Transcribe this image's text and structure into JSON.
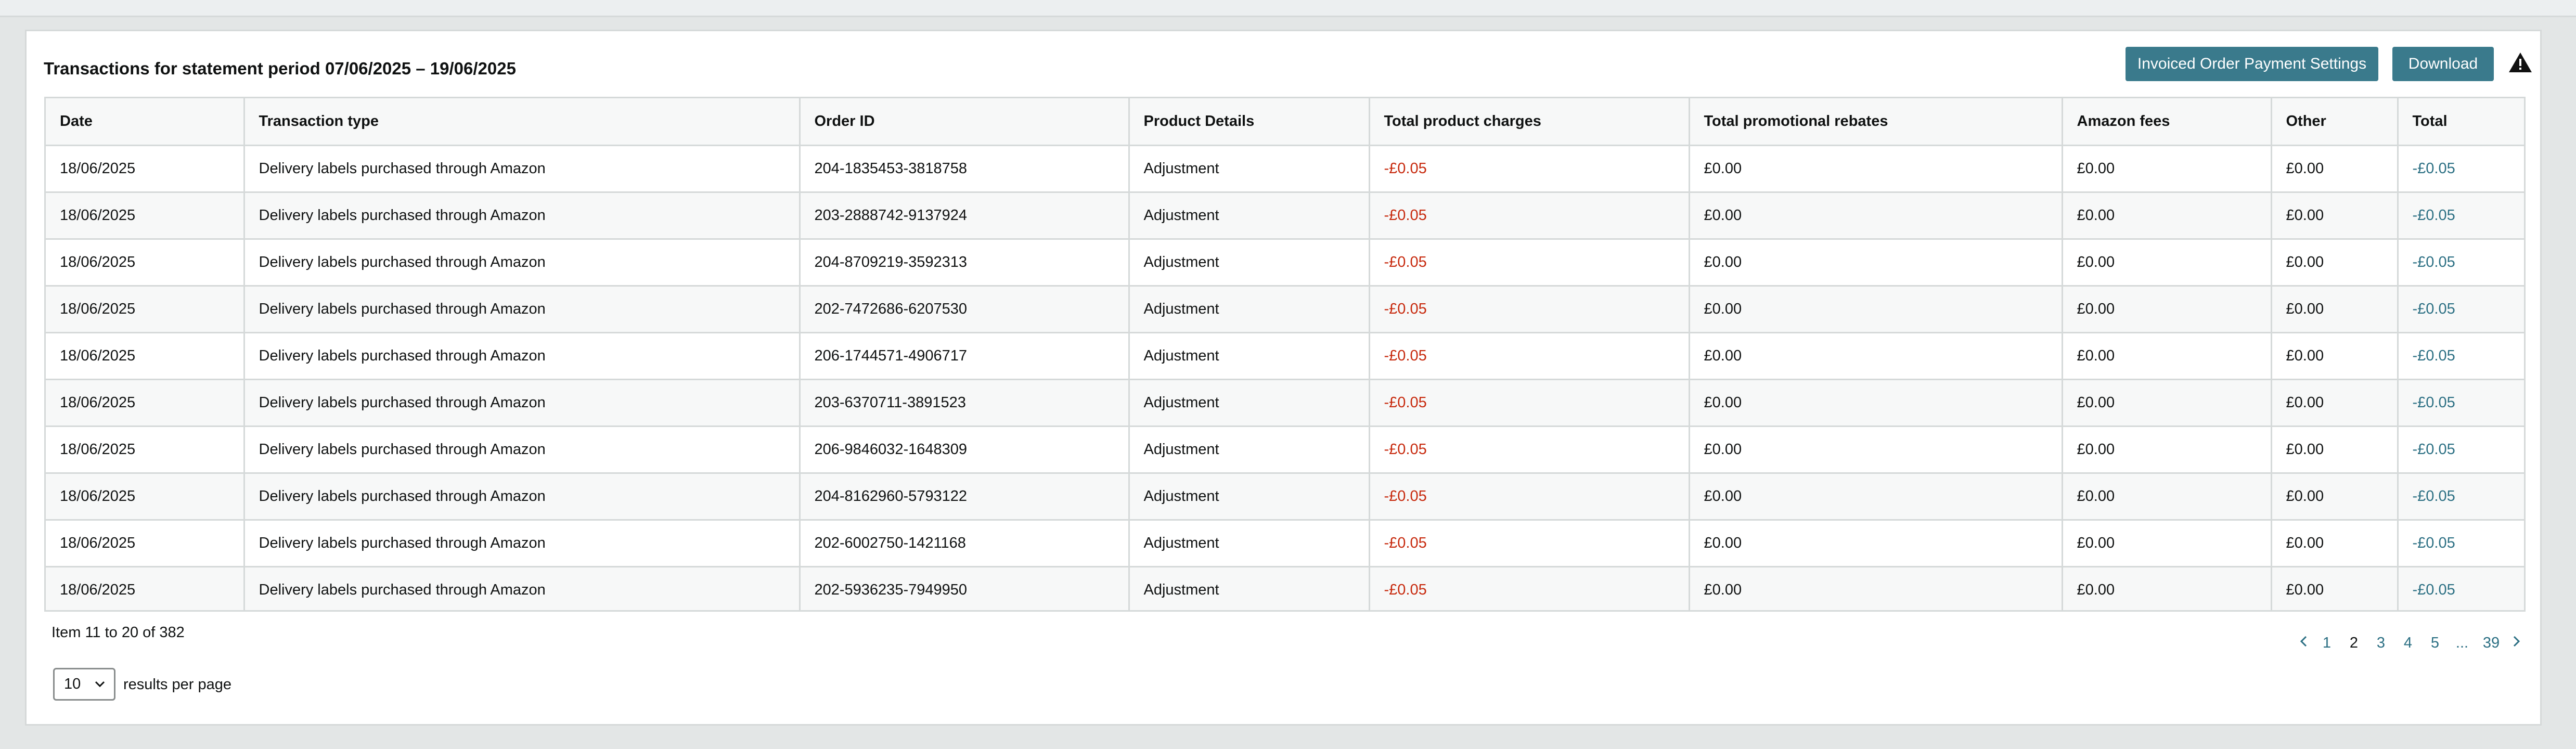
{
  "header": {
    "title": "Transactions for statement period 07/06/2025 – 19/06/2025",
    "settings_button": "Invoiced Order Payment Settings",
    "download_button": "Download",
    "warning_icon": "warning-triangle-icon"
  },
  "table": {
    "columns": [
      "Date",
      "Transaction type",
      "Order ID",
      "Product Details",
      "Total product charges",
      "Total promotional rebates",
      "Amazon fees",
      "Other",
      "Total"
    ],
    "rows": [
      [
        "18/06/2025",
        "Delivery labels purchased through Amazon",
        "204-1835453-3818758",
        "Adjustment",
        "-£0.05",
        "£0.00",
        "£0.00",
        "£0.00",
        "-£0.05"
      ],
      [
        "18/06/2025",
        "Delivery labels purchased through Amazon",
        "203-2888742-9137924",
        "Adjustment",
        "-£0.05",
        "£0.00",
        "£0.00",
        "£0.00",
        "-£0.05"
      ],
      [
        "18/06/2025",
        "Delivery labels purchased through Amazon",
        "204-8709219-3592313",
        "Adjustment",
        "-£0.05",
        "£0.00",
        "£0.00",
        "£0.00",
        "-£0.05"
      ],
      [
        "18/06/2025",
        "Delivery labels purchased through Amazon",
        "202-7472686-6207530",
        "Adjustment",
        "-£0.05",
        "£0.00",
        "£0.00",
        "£0.00",
        "-£0.05"
      ],
      [
        "18/06/2025",
        "Delivery labels purchased through Amazon",
        "206-1744571-4906717",
        "Adjustment",
        "-£0.05",
        "£0.00",
        "£0.00",
        "£0.00",
        "-£0.05"
      ],
      [
        "18/06/2025",
        "Delivery labels purchased through Amazon",
        "203-6370711-3891523",
        "Adjustment",
        "-£0.05",
        "£0.00",
        "£0.00",
        "£0.00",
        "-£0.05"
      ],
      [
        "18/06/2025",
        "Delivery labels purchased through Amazon",
        "206-9846032-1648309",
        "Adjustment",
        "-£0.05",
        "£0.00",
        "£0.00",
        "£0.00",
        "-£0.05"
      ],
      [
        "18/06/2025",
        "Delivery labels purchased through Amazon",
        "204-8162960-5793122",
        "Adjustment",
        "-£0.05",
        "£0.00",
        "£0.00",
        "£0.00",
        "-£0.05"
      ],
      [
        "18/06/2025",
        "Delivery labels purchased through Amazon",
        "202-6002750-1421168",
        "Adjustment",
        "-£0.05",
        "£0.00",
        "£0.00",
        "£0.00",
        "-£0.05"
      ],
      [
        "18/06/2025",
        "Delivery labels purchased through Amazon",
        "202-5936235-7949950",
        "Adjustment",
        "-£0.05",
        "£0.00",
        "£0.00",
        "£0.00",
        "-£0.05"
      ]
    ]
  },
  "footer": {
    "items_text": "Item 11 to 20 of 382",
    "pagination": {
      "prev_icon": "chevron-left-icon",
      "pages": [
        "1",
        "2",
        "3",
        "4",
        "5",
        "...",
        "39"
      ],
      "current": "2",
      "next_icon": "chevron-right-icon"
    },
    "per_page_value": "10",
    "per_page_label": "results per page"
  },
  "colors": {
    "button_bg": "#3a7a8c",
    "negative": "#c7290d",
    "link": "#2b6f83"
  }
}
